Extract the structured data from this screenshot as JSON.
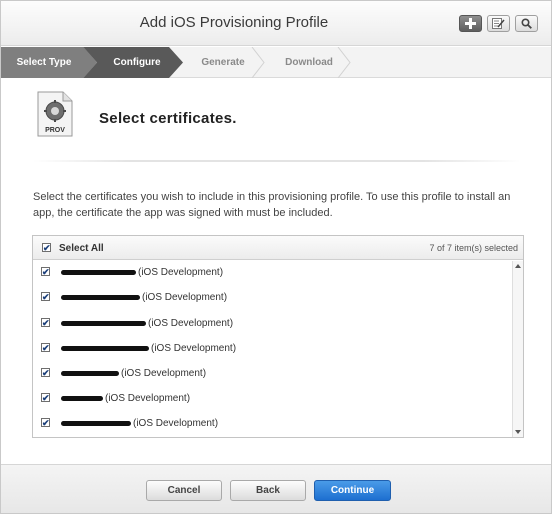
{
  "header": {
    "title": "Add iOS Provisioning Profile",
    "buttons": [
      {
        "name": "add",
        "icon": "plus-icon"
      },
      {
        "name": "edit",
        "icon": "edit-icon"
      },
      {
        "name": "search",
        "icon": "search-icon"
      }
    ]
  },
  "steps": [
    {
      "label": "Select Type",
      "state": "completed"
    },
    {
      "label": "Configure",
      "state": "active"
    },
    {
      "label": "Generate",
      "state": "upcoming"
    },
    {
      "label": "Download",
      "state": "upcoming"
    }
  ],
  "profile_icon": {
    "icon": "provisioning-profile-icon",
    "label": "PROV"
  },
  "heading": "Select certificates.",
  "description": "Select the certificates you wish to include in this provisioning profile. To use this profile to install an app, the certificate the app was signed with must be included.",
  "certificates": {
    "select_all_label": "Select All",
    "select_all_checked": true,
    "count_text": "7 of 7 item(s) selected",
    "items": [
      {
        "role": "(iOS Development)",
        "checked": true,
        "name_redacted": true
      },
      {
        "role": "(iOS Development)",
        "checked": true,
        "name_redacted": true
      },
      {
        "role": "(iOS Development)",
        "checked": true,
        "name_redacted": true
      },
      {
        "role": "(iOS Development)",
        "checked": true,
        "name_redacted": true
      },
      {
        "role": "(iOS Development)",
        "checked": true,
        "name_redacted": true
      },
      {
        "role": "(iOS Development)",
        "checked": true,
        "name_redacted": true
      },
      {
        "role": "(iOS Development)",
        "checked": true,
        "name_redacted": true
      }
    ]
  },
  "footer": {
    "cancel_label": "Cancel",
    "back_label": "Back",
    "continue_label": "Continue"
  },
  "colors": {
    "step_completed": "#7f7f7f",
    "step_active": "#595959",
    "primary_button": "#1d6fd0",
    "checkbox_mark": "#1b3f7a"
  }
}
